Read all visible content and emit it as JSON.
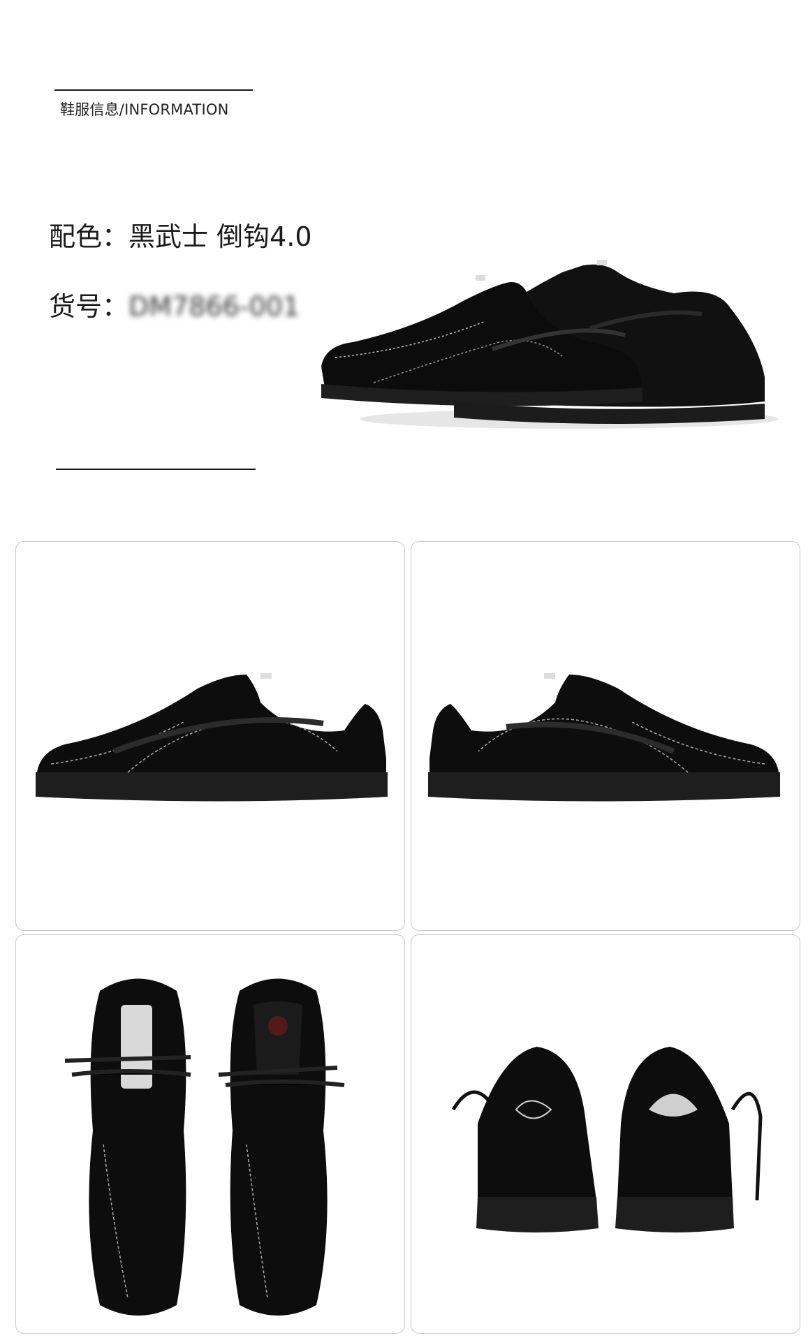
{
  "header": {
    "label": "鞋服信息/INFORMATION"
  },
  "specs": {
    "color_label": "配色：",
    "color_value": "黑武士 倒钩4.0",
    "code_label": "货号：",
    "code_value": "DM7866-001"
  },
  "gallery": {
    "tiles": [
      {
        "name": "side-view-left",
        "icon": "shoe-side-left"
      },
      {
        "name": "side-view-right",
        "icon": "shoe-side-right"
      },
      {
        "name": "top-view",
        "icon": "shoe-top-pair"
      },
      {
        "name": "back-view",
        "icon": "shoe-heel-pair"
      }
    ]
  },
  "colors": {
    "shoe": "#0d0d0d",
    "sole": "#1e1e1e",
    "stitch": "#bdbdbd",
    "tile_border": "#c9c9c9"
  }
}
